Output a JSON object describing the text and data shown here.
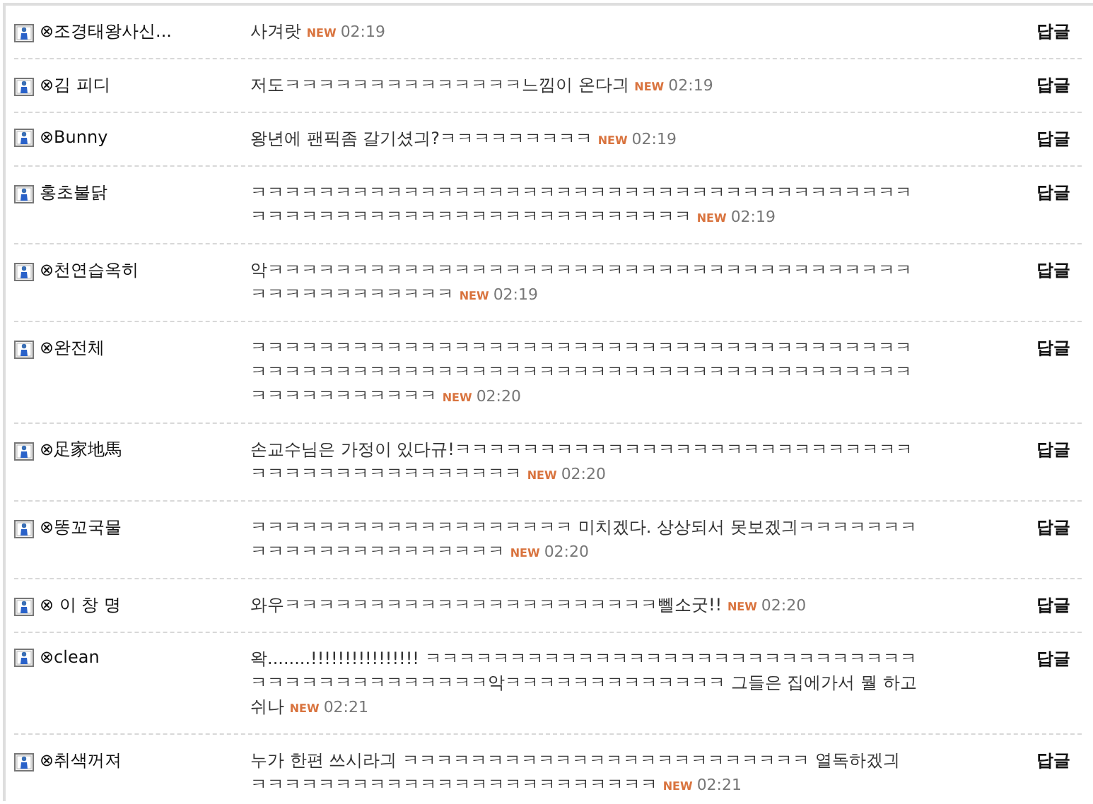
{
  "comments": [
    {
      "name": "⊗조경태왕사신...",
      "text": "사겨랏",
      "badge": "NEW",
      "time": "02:19",
      "reply": "답글"
    },
    {
      "name": "⊗김 피디",
      "text": "저도ㅋㅋㅋㅋㅋㅋㅋㅋㅋㅋㅋㅋㅋㅋ느낌이 온다긔",
      "badge": "NEW",
      "time": "02:19",
      "reply": "답글"
    },
    {
      "name": "⊗Bunny",
      "text": "왕년에 팬픽좀 갈기셨긔?ㅋㅋㅋㅋㅋㅋㅋㅋㅋ",
      "badge": "NEW",
      "time": "02:19",
      "reply": "답글"
    },
    {
      "name": "홍초불닭",
      "text": "ㅋㅋㅋㅋㅋㅋㅋㅋㅋㅋㅋㅋㅋㅋㅋㅋㅋㅋㅋㅋㅋㅋㅋㅋㅋㅋㅋㅋㅋㅋㅋㅋㅋㅋㅋㅋㅋㅋㅋㅋㅋㅋㅋㅋㅋㅋㅋㅋㅋㅋㅋㅋㅋㅋㅋㅋㅋㅋㅋㅋㅋㅋㅋㅋㅋ",
      "badge": "NEW",
      "time": "02:19",
      "reply": "답글"
    },
    {
      "name": "⊗천연습옥히",
      "text": "악ㅋㅋㅋㅋㅋㅋㅋㅋㅋㅋㅋㅋㅋㅋㅋㅋㅋㅋㅋㅋㅋㅋㅋㅋㅋㅋㅋㅋㅋㅋㅋㅋㅋㅋㅋㅋㅋㅋㅋㅋㅋㅋㅋㅋㅋㅋㅋㅋㅋㅋ",
      "badge": "NEW",
      "time": "02:19",
      "reply": "답글"
    },
    {
      "name": "⊗완전체",
      "text": "ㅋㅋㅋㅋㅋㅋㅋㅋㅋㅋㅋㅋㅋㅋㅋㅋㅋㅋㅋㅋㅋㅋㅋㅋㅋㅋㅋㅋㅋㅋㅋㅋㅋㅋㅋㅋㅋㅋㅋㅋㅋㅋㅋㅋㅋㅋㅋㅋㅋㅋㅋㅋㅋㅋㅋㅋㅋㅋㅋㅋㅋㅋㅋㅋㅋㅋㅋㅋㅋㅋㅋㅋㅋㅋㅋㅋㅋㅋㅋㅋㅋㅋㅋㅋㅋㅋㅋㅋㅋ",
      "badge": "NEW",
      "time": "02:20",
      "reply": "답글"
    },
    {
      "name": "⊗足家地馬",
      "text": "손교수님은 가정이 있다규!ㅋㅋㅋㅋㅋㅋㅋㅋㅋㅋㅋㅋㅋㅋㅋㅋㅋㅋㅋㅋㅋㅋㅋㅋㅋㅋㅋㅋㅋㅋㅋㅋㅋㅋㅋㅋㅋㅋㅋㅋㅋㅋㅋ",
      "badge": "NEW",
      "time": "02:20",
      "reply": "답글"
    },
    {
      "name": "⊗똥꼬국물",
      "text": "ㅋㅋㅋㅋㅋㅋㅋㅋㅋㅋㅋㅋㅋㅋㅋㅋㅋㅋㅋ 미치겠다. 상상되서 못보겠긔ㅋㅋㅋㅋㅋㅋㅋㅋㅋㅋㅋㅋㅋㅋㅋㅋㅋㅋㅋㅋㅋㅋ",
      "badge": "NEW",
      "time": "02:20",
      "reply": "답글"
    },
    {
      "name": "⊗ 이 창 명",
      "text": "와우ㅋㅋㅋㅋㅋㅋㅋㅋㅋㅋㅋㅋㅋㅋㅋㅋㅋㅋㅋㅋㅋㅋ뻴소굿!!",
      "badge": "NEW",
      "time": "02:20",
      "reply": "답글"
    },
    {
      "name": "⊗clean",
      "text": "왁........!!!!!!!!!!!!!!!! ㅋㅋㅋㅋㅋㅋㅋㅋㅋㅋㅋㅋㅋㅋㅋㅋㅋㅋㅋㅋㅋㅋㅋㅋㅋㅋㅋㅋㅋㅋㅋㅋㅋㅋㅋㅋㅋㅋㅋㅋㅋㅋㅋ악ㅋㅋㅋㅋㅋㅋㅋㅋㅋㅋㅋㅋㅋ 그들은 집에가서 뭘 하고 쉬나",
      "badge": "NEW",
      "time": "02:21",
      "reply": "답글"
    },
    {
      "name": "⊗취색꺼져",
      "text": "누가 한편 쓰시라긔 ㅋㅋㅋㅋㅋㅋㅋㅋㅋㅋㅋㅋㅋㅋㅋㅋㅋㅋㅋㅋㅋㅋㅋㅋ 열독하겠긔 ㅋㅋㅋㅋㅋㅋㅋㅋㅋㅋㅋㅋㅋㅋㅋㅋㅋㅋㅋㅋㅋㅋㅋㅋ",
      "badge": "NEW",
      "time": "02:21",
      "reply": "답글"
    }
  ]
}
